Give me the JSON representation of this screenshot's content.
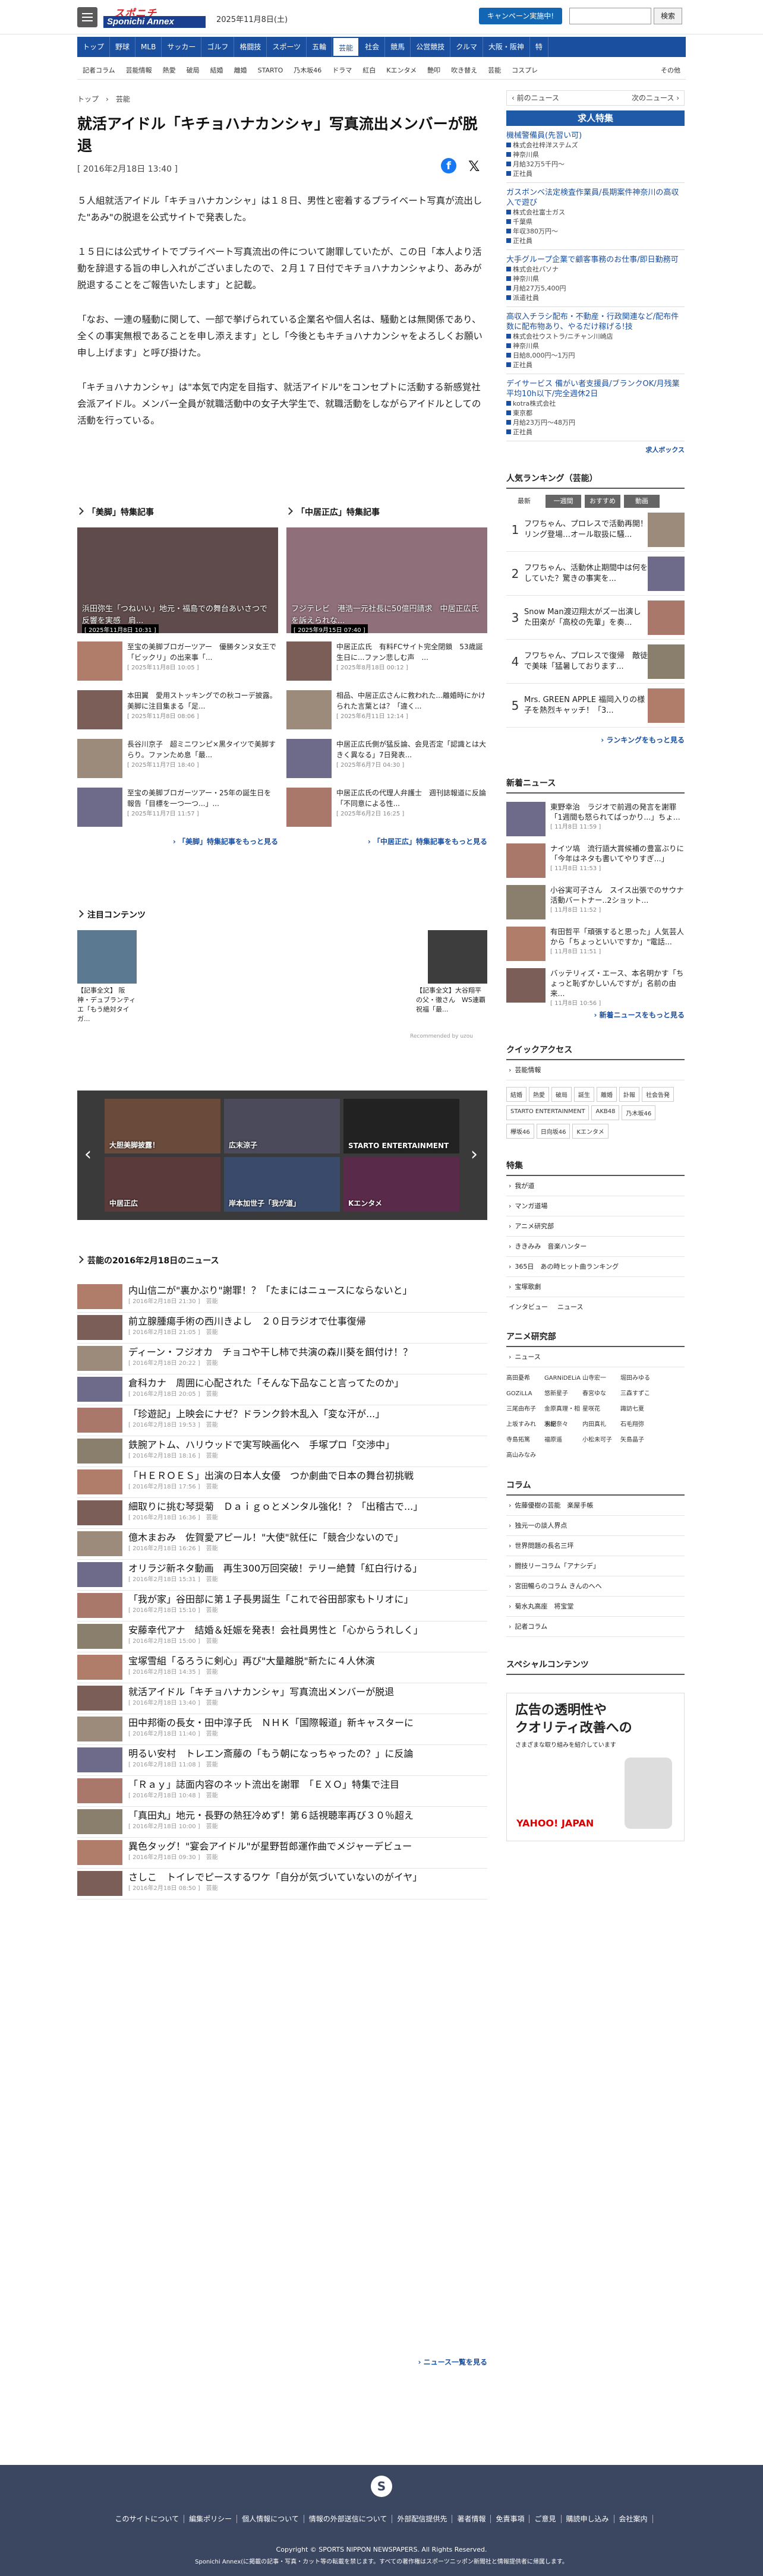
{
  "header": {
    "logo_top": "スポニチ",
    "logo_bottom": "Sponichi Annex",
    "date": "2025年11月8日(土)",
    "campaign": "キャンペーン実施中!",
    "search_btn": "検索"
  },
  "gnav": [
    "トップ",
    "野球",
    "MLB",
    "サッカー",
    "ゴルフ",
    "格闘技",
    "スポーツ",
    "五輪",
    "芸能",
    "社会",
    "競馬",
    "公営競技",
    "クルマ",
    "大阪・阪神",
    "特"
  ],
  "snav": [
    "記者コラム",
    "芸能情報",
    "熱愛",
    "破局",
    "結婚",
    "離婚",
    "STARTO",
    "乃木坂46",
    "ドラマ",
    "紅白",
    "Kエンタメ",
    "艶叩",
    "吹き替え",
    "芸能",
    "コスプレ"
  ],
  "snav_more": "その他",
  "crumb": [
    "トップ",
    "芸能"
  ],
  "pager": {
    "prev": "前のニュース",
    "next": "次のニュース"
  },
  "article": {
    "title": "就活アイドル「キチョハナカンシャ」写真流出メンバーが脱退",
    "date": "[ 2016年2月18日 13:40 ]",
    "p1": "５人組就活アイドル「キチョハナカンシャ」は１８日、男性と密着するプライベート写真が流出した\"あみ\"の脱退を公式サイトで発表した。",
    "p2": "１５日には公式サイトでプライベート写真流出の件について謝罪していたが、この日「本人より活動を辞退する旨の申し入れがございましたので、２月１７日付でキチョハナカンシャより、あみが脱退することをご報告いたします」と記載。",
    "p3": "「なお、一連の騒動に関して、一部で挙げられている企業名や個人名は、騒動とは無関係であり、全くの事実無根であることを申し添えます」とし「今後ともキチョハナカンシャをよろしくお願い申し上げます」と呼び掛けた。",
    "p4": "「キチョハナカンシャ」は\"本気で内定を目指す、就活アイドル\"をコンセプトに活動する新感覚社会派アイドル。メンバー全員が就職活動中の女子大学生で、就職活動をしながらアイドルとしての活動を行っている。"
  },
  "featA": {
    "head": "「美脚」特集記事",
    "hero_cap": "浜田弥生「つねいい」地元・福島での舞台あいさつで反響を実感　肩...",
    "hero_date": "[ 2025年11月8日 10:31 ]",
    "items": [
      {
        "t": "至宝の美脚ブロガーツアー　優勝タンヌ女王で「ビックリ」の出来事「...",
        "d": "[ 2025年11月8日 10:05 ]"
      },
      {
        "t": "本田翼　愛用ストッキングでの秋コーデ披露。美脚に注目集まる「足...",
        "d": "[ 2025年11月8日 08:06 ]"
      },
      {
        "t": "長谷川京子　超ミニワンピ×黒タイツで美脚すらり。ファンため息「最...",
        "d": "[ 2025年11月7日 18:40 ]"
      },
      {
        "t": "至宝の美脚ブロガーツアー・25年の誕生日を報告「目標を一つ一つ...」...",
        "d": "[ 2025年11月7日 11:57 ]"
      }
    ],
    "more": "「美脚」特集記事をもっと見る"
  },
  "featB": {
    "head": "「中居正広」特集記事",
    "hero_cap": "フジテレビ　港浩一元社長に50億円請求　中居正広氏を訴えられな...",
    "hero_date": "[ 2025年9月15日 07:40 ]",
    "items": [
      {
        "t": "中居正広氏　有料FCサイト完全閉鎖　53歳誕生日に...ファン悲しむ声　...",
        "d": "[ 2025年8月18日 00:12 ]"
      },
      {
        "t": "相品、中居正広さんに救われた...離婚時にかけられた言葉とは？「違く...",
        "d": "[ 2025年6月11日 12:14 ]"
      },
      {
        "t": "中居正広氏側が猛反論、会見否定「認識とは大きく異なる」7日発表...",
        "d": "[ 2025年6月7日 04:30 ]"
      },
      {
        "t": "中居正広氏の代理人弁護士　週刊誌報道に反論「不同意による性...",
        "d": "[ 2025年6月2日 16:25 ]"
      }
    ],
    "more": "「中居正広」特集記事をもっと見る"
  },
  "attention": {
    "head": "注目コンテンツ",
    "left": "【記事全文】 阪神・デュブランティエ「もう絶対タイガ...",
    "right": "【記事全文】大谷翔平の父・徹さん　WS連覇祝福「最...",
    "rec": "Recommended by uzou"
  },
  "banner": [
    {
      "t": "大胆美脚披露！"
    },
    {
      "t": "広末涼子"
    },
    {
      "t": "STARTO ENTERTAINMENT"
    },
    {
      "t": "中居正広"
    },
    {
      "t": "岸本加世子「我が道」"
    },
    {
      "t": "Kエンタメ"
    }
  ],
  "daynews": {
    "head": "芸能の2016年2月18日のニュース",
    "items": [
      {
        "t": "内山信二が\"裏かぶり\"謝罪！？「たまにはニュースにならないと」",
        "d": "[ 2016年2月18日 21:30 ]　芸能"
      },
      {
        "t": "前立腺腫瘍手術の西川きよし　２０日ラジオで仕事復帰",
        "d": "[ 2016年2月18日 21:05 ]　芸能"
      },
      {
        "t": "ディーン・フジオカ　チョコや干し柿で共演の森川葵を餌付け！？",
        "d": "[ 2016年2月18日 20:22 ]　芸能"
      },
      {
        "t": "倉科カナ　周囲に心配された「そんな下品なこと言ってたのか」",
        "d": "[ 2016年2月18日 20:05 ]　芸能"
      },
      {
        "t": "「珍遊記」上映会にナゼ？ドランク鈴木乱入「変な汗が...」",
        "d": "[ 2016年2月18日 19:53 ]　芸能"
      },
      {
        "t": "鉄腕アトム、ハリウッドで実写映画化へ　手塚プロ「交渉中」",
        "d": "[ 2016年2月18日 18:16 ]　芸能"
      },
      {
        "t": "「ＨＥＲＯＥＳ」出演の日本人女優　つか劇曲で日本の舞台初挑戦",
        "d": "[ 2016年2月18日 17:56 ]　芸能"
      },
      {
        "t": "細取りに挑む琴奨菊　Ｄａｉｇｏとメンタル強化！？「出稽古で...」",
        "d": "[ 2016年2月18日 16:36 ]　芸能"
      },
      {
        "t": "億木まおみ　佐賀愛アピール！\"大使\"就任に「競合少ないので」",
        "d": "[ 2016年2月18日 16:26 ]　芸能"
      },
      {
        "t": "オリラジ新ネタ動画　再生300万回突破！テリー絶賛「紅白行ける」",
        "d": "[ 2016年2月18日 15:31 ]　芸能"
      },
      {
        "t": "「我が家」谷田部に第１子長男誕生「これで谷田部家もトリオに」",
        "d": "[ 2016年2月18日 15:10 ]　芸能"
      },
      {
        "t": "安藤幸代アナ　結婚＆妊娠を発表！会社員男性と「心からうれしく」",
        "d": "[ 2016年2月18日 15:00 ]　芸能"
      },
      {
        "t": "宝塚雪組「るろうに剣心」再び\"大量離脱\"新たに４人休演",
        "d": "[ 2016年2月18日 14:35 ]　芸能"
      },
      {
        "t": "就活アイドル「キチョハナカンシャ」写真流出メンバーが脱退",
        "d": "[ 2016年2月18日 13:40 ]　芸能"
      },
      {
        "t": "田中邦衛の長女・田中淳子氏　ＮＨＫ「国際報道」新キャスターに",
        "d": "[ 2016年2月18日 11:40 ]　芸能"
      },
      {
        "t": "明るい安村　トレエン斎藤の「もう朝になっちゃったの？」に反論",
        "d": "[ 2016年2月18日 11:08 ]　芸能"
      },
      {
        "t": "「Ｒａｙ」誌面内容のネット流出を謝罪　「ＥＸＯ」特集で注目",
        "d": "[ 2016年2月18日 10:48 ]　芸能"
      },
      {
        "t": "「真田丸」地元・長野の熱狂冷めず！第６話視聴率再び３０％超え",
        "d": "[ 2016年2月18日 10:00 ]　芸能"
      },
      {
        "t": "異色タッグ！\"宴会アイドル\"が星野哲郎運作曲でメジャーデビュー",
        "d": "[ 2016年2月18日 09:30 ]　芸能"
      },
      {
        "t": "さしこ　トイレでピースするワケ「自分が気づいていないのがイヤ」",
        "d": "[ 2016年2月18日 08:50 ]　芸能"
      }
    ],
    "more": "ニュース一覧を見る"
  },
  "side": {
    "jobs_head": "求人特集",
    "jobs": [
      {
        "t": "機械警備員(先習い可)",
        "c": "株式会社梓洋ステムズ",
        "a": "神奈川県",
        "s": "月給32万5千円〜",
        "e": "正社員"
      },
      {
        "t": "ガスボンベ法定検査作業員/長期案件神奈川の高収入で遊び",
        "c": "株式会社富士ガス",
        "a": "千葉県",
        "s": "年収380万円〜",
        "e": "正社員"
      },
      {
        "t": "大手グループ企業で顧客事務のお仕事/即日勤務可",
        "c": "株式会社パソナ",
        "a": "神奈川県",
        "s": "月給27万5,400円",
        "e": "派遣社員"
      },
      {
        "t": "高収入チラシ配布・不動産・行政関連など/配布件数に配布物あり、やるだけ稼げる!技",
        "c": "株式会社ウストラ/ニチャン川崎店",
        "a": "神奈川県",
        "s": "日給8,000円〜1万円",
        "e": "正社員"
      },
      {
        "t": "デイサービス 備がい者支援員/ブランクOK/月残業平均10h以下/完全週休2日",
        "c": "kotra株式会社",
        "a": "東京都",
        "s": "月給23万円〜48万円",
        "e": "正社員"
      }
    ],
    "jobs_footer": "求人ボックス",
    "rank_head": "人気ランキング（芸能）",
    "rank_tabs": [
      "最新",
      "一週間",
      "おすすめ",
      "動画"
    ],
    "rank": [
      {
        "n": "1",
        "t": "フワちゃん、プロレスで活動再開！リング登場…オール取扱に騒..."
      },
      {
        "n": "2",
        "t": "フワちゃん、活動休止期間中は何をしていた？驚きの事実を..."
      },
      {
        "n": "3",
        "t": "Snow Man渡辺翔太がズー出演した田楽が「高校の先輩」を奏..."
      },
      {
        "n": "4",
        "t": "フワちゃん、プロレスで復帰　敵徒で美味「猛暑しております..."
      },
      {
        "n": "5",
        "t": "Mrs. GREEN APPLE 福岡入りの様子を熱烈キャッチ！「3..."
      }
    ],
    "rank_more": "ランキングをもっと見る",
    "snews_head": "新着ニュース",
    "snews": [
      {
        "t": "東野幸治　ラジオで前週の発言を謝罪「1週間も怒られてばっかり...」ちょ...",
        "d": "[ 11月8日 11:59 ]"
      },
      {
        "t": "ナイツ塙　流行語大賞候補の豊富ぶりに「今年はネタも書いてやりすぎ...」",
        "d": "[ 11月8日 11:53 ]"
      },
      {
        "t": "小谷実可子さん　スイス出張でのサウナ活動バートナー..2ショット...",
        "d": "[ 11月8日 11:52 ]"
      },
      {
        "t": "有田哲平「頑張すると思った」人気芸人から「ちょっといいですか」\"電話...",
        "d": "[ 11月8日 11:51 ]"
      },
      {
        "t": "バッテリィズ・エース、本名明かす「ちょっと恥ずかしいんですが」名前の由来...",
        "d": "[ 11月8日 10:56 ]"
      }
    ],
    "snews_more": "新着ニュースをもっと見る",
    "qa_head": "クイックアクセス",
    "qa_first": "芸能情報",
    "qa_tags": [
      "結婚",
      "熱愛",
      "破局",
      "誕生",
      "離婚",
      "訃報",
      "社会告発",
      "STARTO ENTERTAINMENT",
      "AKB48",
      "乃木坂46",
      "欅坂46",
      "日向坂46",
      "Kエンタメ"
    ],
    "sp_head": "特集",
    "sp": [
      "我が道",
      "マンガ道場",
      "アニメ研究部",
      "ききみみ　音楽ハンター",
      "365日　あの時ヒット曲ランキング",
      "宝塚歌劇"
    ],
    "sp_links": [
      "インタビュー",
      "ニュース"
    ],
    "anime_head": "アニメ研究部",
    "anime_first": "ニュース",
    "anime_names": [
      "高田憂希",
      "GARNiDELiA",
      "山寺宏一",
      "堀田みゆる",
      "GOZiLLA",
      "悠新星子",
      "春宮ゆな",
      "三森すずこ",
      "三尾由布子",
      "金原真理・相羽紀",
      "星咲花",
      "諏訪七夏",
      "上坂すみれ",
      "水樹奈々",
      "内田真礼",
      "石毛翔弥",
      "寺島拓篤",
      "福原遥",
      "小松未可子",
      "矢島晶子",
      "高山みなみ"
    ],
    "col_head": "コラム",
    "col": [
      "佐藤優樹の芸能　楽屋手帳",
      "独元一の談人界点",
      "世界問題の長名三坪",
      "闘技リーコラム「アナシデ」",
      "宮田暢らのコラム きんのへへ",
      "菊水丸高座　将宝堂",
      "記者コラム"
    ],
    "spc_head": "スペシャルコンテンツ",
    "ad_line1": "広告の透明性や",
    "ad_line2": "クオリティ改善への",
    "ad_line3": "さまざまな取り組みを紹介しています",
    "ad_logo": "YAHOO! JAPAN"
  },
  "footer": {
    "logo": "S",
    "links": [
      "このサイトについて",
      "編集ポリシー",
      "個人情報について",
      "情報の外部送信について",
      "外部配信提供先",
      "著者情報",
      "免責事項",
      "ご意見",
      "購読申し込み",
      "会社案内"
    ],
    "copy": "Copyright © SPORTS NIPPON NEWSPAPERS. All Rights Reserved.",
    "copy2": "Sponichi Annex(に掲載の記事・写真・カット等の転載を禁じます。すべての著作権はスポーツニッポン新聞社と情報提供者に帰属します。"
  }
}
